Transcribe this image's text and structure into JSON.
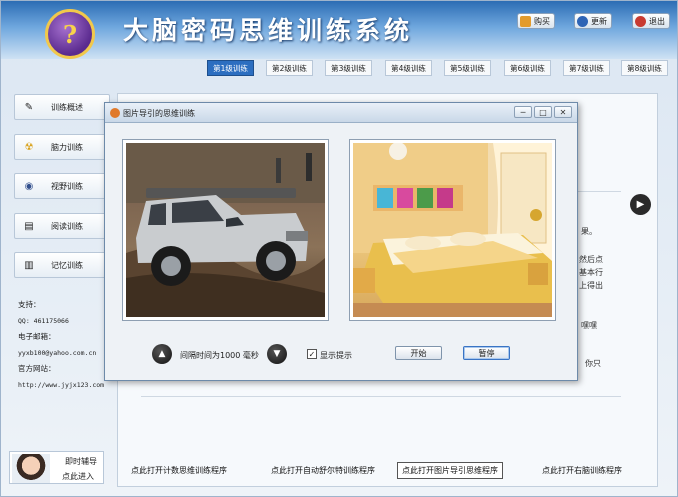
{
  "header": {
    "logo_glyph": "?",
    "title": "大脑密码思维训练系统",
    "buttons": [
      {
        "label": "购买",
        "icon": "cart-icon"
      },
      {
        "label": "更新",
        "icon": "help-icon"
      },
      {
        "label": "退出",
        "icon": "exit-icon"
      }
    ]
  },
  "tabs": [
    {
      "label": "第1级训练",
      "active": true
    },
    {
      "label": "第2级训练"
    },
    {
      "label": "第3级训练"
    },
    {
      "label": "第4级训练"
    },
    {
      "label": "第5级训练"
    },
    {
      "label": "第6级训练"
    },
    {
      "label": "第7级训练"
    },
    {
      "label": "第8级训练"
    }
  ],
  "sidebar": {
    "items": [
      {
        "label": "训练概述",
        "icon": "pen-icon"
      },
      {
        "label": "脑力训练",
        "icon": "radiation-icon"
      },
      {
        "label": "视野训练",
        "icon": "eye-icon"
      },
      {
        "label": "阅读训练",
        "icon": "book-icon"
      },
      {
        "label": "记忆训练",
        "icon": "notebook-icon"
      }
    ]
  },
  "contact": {
    "support_label": "支持：",
    "qq": "QQ: 461175066",
    "email_label": "电子邮箱：",
    "email": "yyxb100@yahoo.com.cn",
    "site_label": "官方网站：",
    "site": "http://www.jyjx123.com"
  },
  "helper": {
    "title": "即时辅导",
    "action": "点此进入"
  },
  "main": {
    "bg_fragments": [
      "果。",
      "然后点",
      "基本行",
      "上得出",
      "嘿嘿",
      "你只"
    ],
    "bottom_links": [
      "点此打开计数思维训练程序",
      "点此打开自动舒尔特训练程序",
      "点此打开图片导引思维程序",
      "点此打开右脑训练程序"
    ]
  },
  "dialog": {
    "title": "图片导引的思维训练",
    "window_buttons": [
      "─",
      "□",
      "✕"
    ],
    "left_image": "suv-offroad-photo",
    "right_image": "bedroom-photo",
    "up_glyph": "▲",
    "down_glyph": "▼",
    "interval_text": "间隔时间为1000  毫秒",
    "checkbox_checked": "✓",
    "checkbox_label": "显示提示",
    "start_label": "开始",
    "pause_label": "暂停"
  },
  "colors": {
    "header_top": "#2c6db4",
    "tab_active": "#2c6ec0",
    "accent_gold": "#f1c84b"
  }
}
